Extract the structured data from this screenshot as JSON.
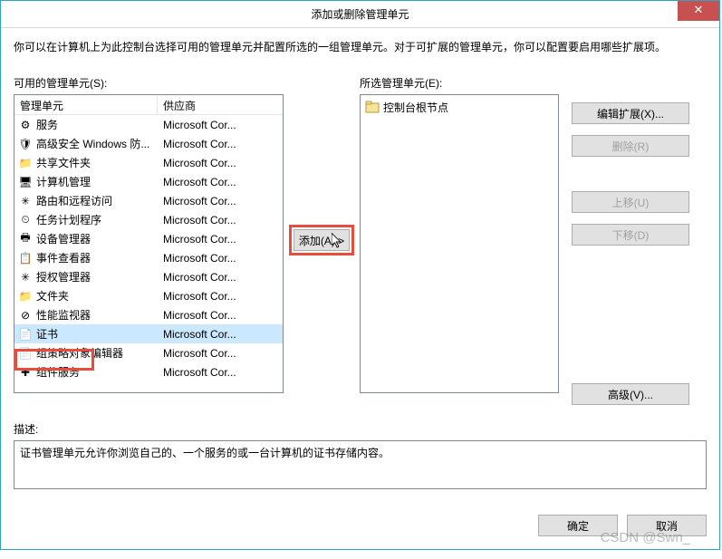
{
  "titlebar": {
    "title": "添加或删除管理单元"
  },
  "instruction": "你可以在计算机上为此控制台选择可用的管理单元并配置所选的一组管理单元。对于可扩展的管理单元，你可以配置要启用哪些扩展项。",
  "available_label": "可用的管理单元(S):",
  "selected_label": "所选管理单元(E):",
  "columns": {
    "name": "管理单元",
    "vendor": "供应商"
  },
  "snapins": [
    {
      "name": "服务",
      "vendor": "Microsoft Cor...",
      "icon": "gear-icon"
    },
    {
      "name": "高级安全 Windows 防...",
      "vendor": "Microsoft Cor...",
      "icon": "shield-icon"
    },
    {
      "name": "共享文件夹",
      "vendor": "Microsoft Cor...",
      "icon": "folder-share-icon"
    },
    {
      "name": "计算机管理",
      "vendor": "Microsoft Cor...",
      "icon": "computer-icon"
    },
    {
      "name": "路由和远程访问",
      "vendor": "Microsoft Cor...",
      "icon": "network-icon"
    },
    {
      "name": "任务计划程序",
      "vendor": "Microsoft Cor...",
      "icon": "clock-icon"
    },
    {
      "name": "设备管理器",
      "vendor": "Microsoft Cor...",
      "icon": "device-icon"
    },
    {
      "name": "事件查看器",
      "vendor": "Microsoft Cor...",
      "icon": "event-icon"
    },
    {
      "name": "授权管理器",
      "vendor": "Microsoft Cor...",
      "icon": "key-icon"
    },
    {
      "name": "文件夹",
      "vendor": "Microsoft Cor...",
      "icon": "folder-icon"
    },
    {
      "name": "性能监视器",
      "vendor": "Microsoft Cor...",
      "icon": "perf-icon"
    },
    {
      "name": "证书",
      "vendor": "Microsoft Cor...",
      "icon": "certificate-icon",
      "selected": true
    },
    {
      "name": "组策略对象编辑器",
      "vendor": "Microsoft Cor...",
      "icon": "policy-icon"
    },
    {
      "name": "组件服务",
      "vendor": "Microsoft Cor...",
      "icon": "component-icon"
    }
  ],
  "selected_tree": {
    "root": "控制台根节点",
    "icon": "console-root-icon"
  },
  "buttons": {
    "add": "添加(A) >",
    "edit_ext": "编辑扩展(X)...",
    "remove": "删除(R)",
    "move_up": "上移(U)",
    "move_down": "下移(D)",
    "advanced": "高级(V)...",
    "ok": "确定",
    "cancel": "取消"
  },
  "description": {
    "label": "描述:",
    "text": "证书管理单元允许你浏览自己的、一个服务的或一台计算机的证书存储内容。"
  },
  "watermark": "CSDN @Swn_",
  "icon_glyph": {
    "gear-icon": "⚙",
    "shield-icon": "🛡",
    "folder-share-icon": "📁",
    "computer-icon": "🖥",
    "network-icon": "✳",
    "clock-icon": "⏲",
    "device-icon": "🖶",
    "event-icon": "📋",
    "key-icon": "✳",
    "folder-icon": "📁",
    "perf-icon": "⊘",
    "certificate-icon": "📄",
    "policy-icon": "📄",
    "component-icon": "✚",
    "console-root-icon": "📁"
  }
}
